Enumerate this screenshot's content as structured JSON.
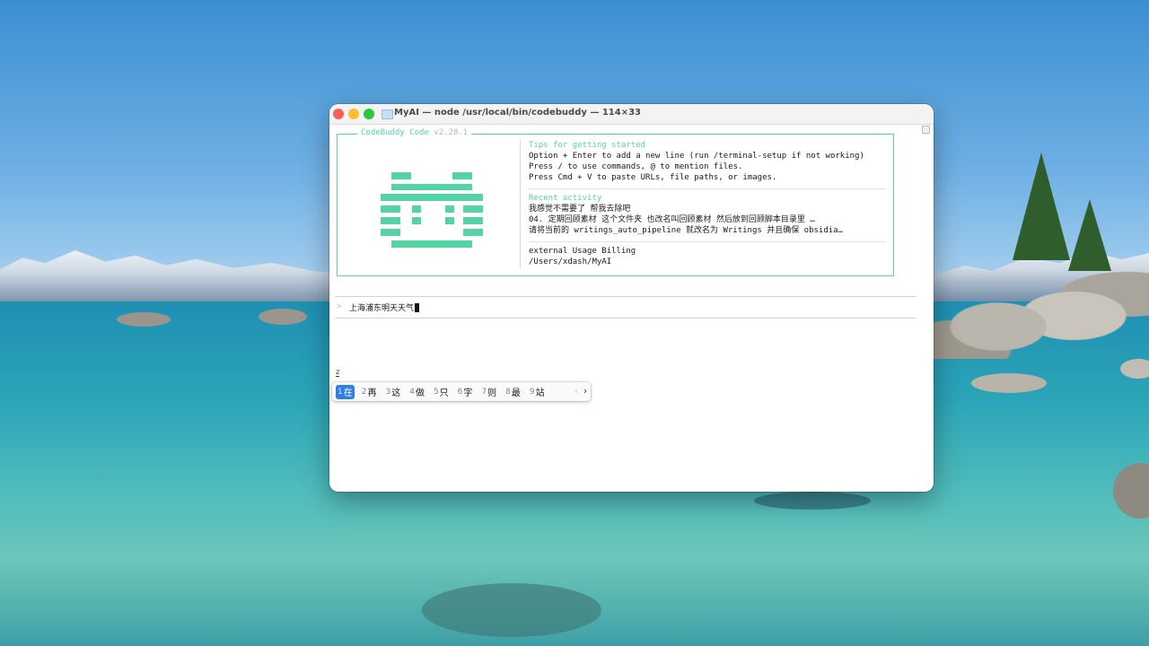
{
  "window": {
    "title": "MyAI — node /usr/local/bin/codebuddy — 114×33"
  },
  "welcome": {
    "app_name": "CodeBuddy Code",
    "version": "v2.28.1",
    "tips_title": "Tips for getting started",
    "tips": [
      "Option + Enter to add a new line (run /terminal-setup if not working)",
      "Press / to use commands, @ to mention files.",
      "Press Cmd + V to paste URLs, file paths, or images."
    ],
    "recent_title": "Recent activity",
    "recent": [
      "我感觉不需要了 帮我去除吧",
      "04. 定期回顾素材 这个文件夹  也改名叫回顾素材 然后放到回顾脚本目录里 …",
      " 请将当前的 writings_auto_pipeline 就改名为 Writings 并且确保 obsidia…"
    ],
    "account": "external Usage Billing",
    "cwd": "/Users/xdash/MyAI"
  },
  "prompt": {
    "chevron": ">",
    "input": "上海浦东明天天气"
  },
  "ime": {
    "composition": "z",
    "candidates": [
      {
        "num": "1",
        "text": "在"
      },
      {
        "num": "2",
        "text": "再"
      },
      {
        "num": "3",
        "text": "这"
      },
      {
        "num": "4",
        "text": "做"
      },
      {
        "num": "5",
        "text": "只"
      },
      {
        "num": "6",
        "text": "字"
      },
      {
        "num": "7",
        "text": "则"
      },
      {
        "num": "8",
        "text": "最"
      },
      {
        "num": "9",
        "text": "站"
      }
    ],
    "prev": "‹",
    "next": "›"
  }
}
